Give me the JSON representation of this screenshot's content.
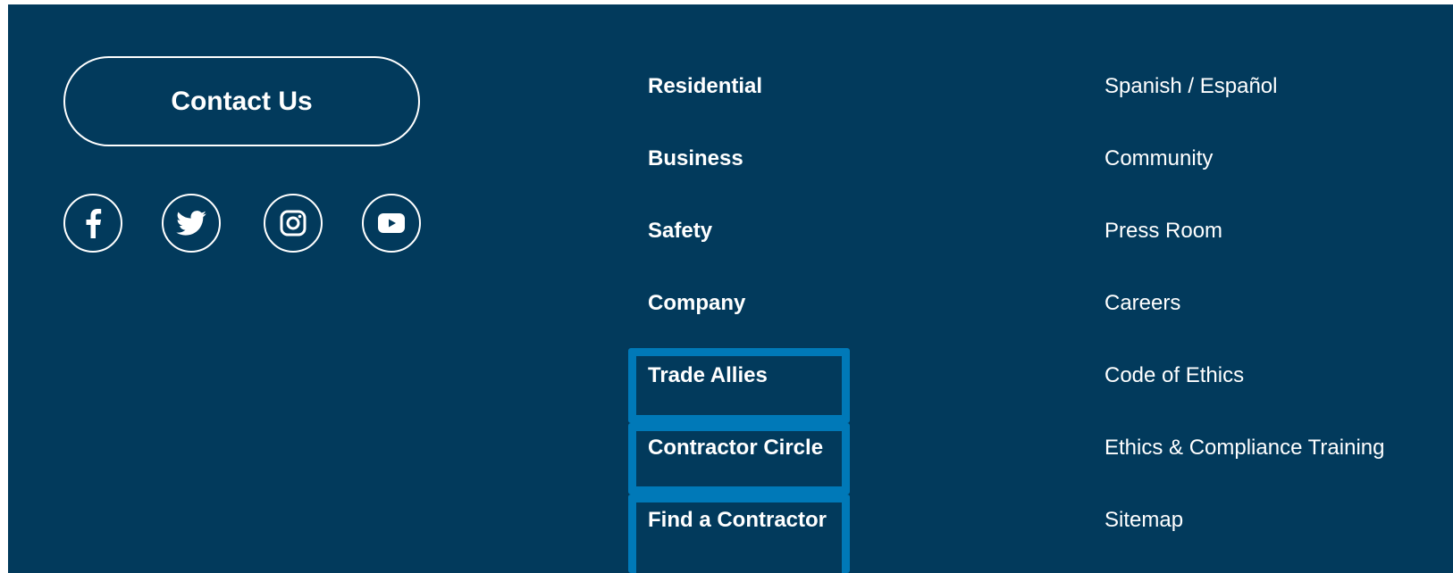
{
  "contact": {
    "label": "Contact Us"
  },
  "social": [
    {
      "name": "facebook-icon"
    },
    {
      "name": "twitter-icon"
    },
    {
      "name": "instagram-icon"
    },
    {
      "name": "youtube-icon"
    }
  ],
  "nav": {
    "items": [
      {
        "label": "Residential"
      },
      {
        "label": "Business"
      },
      {
        "label": "Safety"
      },
      {
        "label": "Company"
      },
      {
        "label": "Trade Allies"
      },
      {
        "label": "Contractor Circle"
      },
      {
        "label": "Find a Contractor"
      }
    ]
  },
  "links": {
    "items": [
      {
        "label": "Spanish / Español"
      },
      {
        "label": "Community"
      },
      {
        "label": "Press Room"
      },
      {
        "label": "Careers"
      },
      {
        "label": "Code of Ethics"
      },
      {
        "label": "Ethics & Compliance Training"
      },
      {
        "label": "Sitemap"
      }
    ]
  },
  "colors": {
    "background": "#023a5c",
    "text": "#ffffff",
    "highlight": "#0079b8"
  }
}
